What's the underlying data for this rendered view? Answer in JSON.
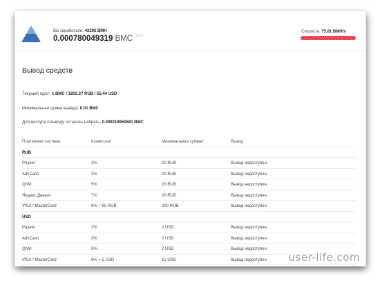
{
  "header": {
    "earned_label": "Вы заработали:",
    "earned_value": "43292 BMH",
    "balance_value": "0.000780049319",
    "balance_currency": "BMC",
    "balance_suffix": "1179",
    "speed_label": "Скорость:",
    "speed_value": "75.81 BMH/s",
    "colors": {
      "speed_bar": "#e44a54",
      "logo": "#4a7fc1"
    }
  },
  "withdraw": {
    "title": "Вывод средств",
    "rate_label": "Текущий курс¹:",
    "rate_value": "1 BMC / 3202.27 RUB / 55.44 USD",
    "min_label": "Минимальная сумма вывода:",
    "min_value": "0.01 BMC",
    "remaining_label": "Для доступа к выводу осталось набрать:",
    "remaining_value": "0.009219950681 BMC"
  },
  "table": {
    "headers": [
      "Платежная система",
      "Комиссии²",
      "Минимальная сумма³",
      "Вывод"
    ],
    "groups": [
      {
        "name": "RUB",
        "rows": [
          [
            "Payeer",
            "2%",
            "20 RUB",
            "Вывод недоступен"
          ],
          [
            "AdvCash",
            "3%",
            "20 RUB",
            "Вывод недоступен"
          ],
          [
            "QIWI",
            "5%",
            "20 RUB",
            "Вывод недоступен"
          ],
          [
            "Яндекс.Деньги",
            "7%",
            "20 RUB",
            "Вывод недоступен"
          ],
          [
            "VISA / MasterCard",
            "6% + 65 RUB",
            "200 RUB",
            "Вывод недоступен"
          ]
        ]
      },
      {
        "name": "USD",
        "rows": [
          [
            "Payeer",
            "2%",
            "2 USD",
            "Вывод недоступен"
          ],
          [
            "AdvCash",
            "3%",
            "2 USD",
            "Вывод недоступен"
          ],
          [
            "QIWI",
            "5%",
            "2 USD",
            "Вывод недоступен"
          ],
          [
            "VISA / MasterCard",
            "6% + 5 USD",
            "15 USD",
            "Вывод недоступен"
          ]
        ]
      }
    ]
  },
  "watermark": "user-life.com"
}
